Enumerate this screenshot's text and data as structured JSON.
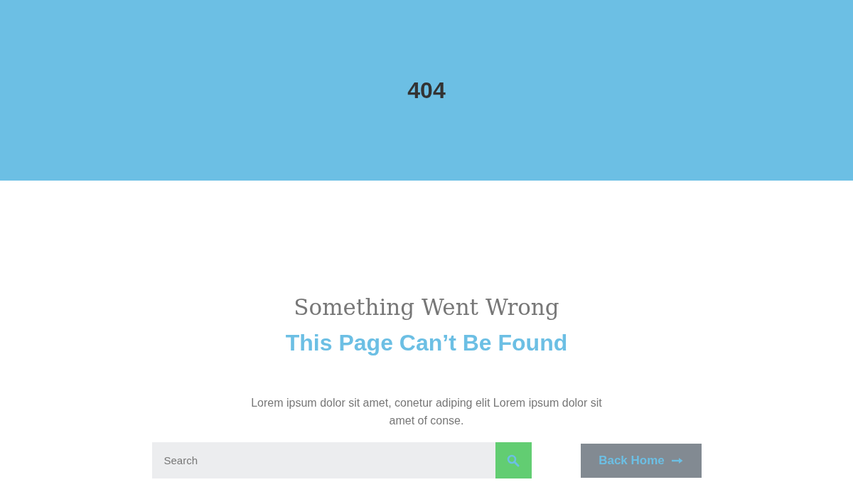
{
  "banner": {
    "title": "404"
  },
  "headline": "Something Went Wrong",
  "subtitle": "This Page Can’t Be Found",
  "message": "Lorem ipsum dolor sit amet, conetur adiping elit Lorem ipsum dolor sit amet of conse.",
  "search": {
    "placeholder": "Search"
  },
  "home_button": {
    "label": "Back Home"
  }
}
